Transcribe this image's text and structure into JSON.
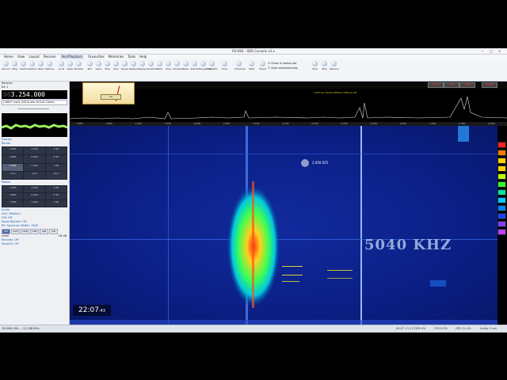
{
  "window": {
    "title": "RX-666 - SDR Console v3.x",
    "controls": [
      "—",
      "□",
      "✕"
    ]
  },
  "menu": [
    "Home",
    "View",
    "Layout",
    "Receive",
    "Rec/Playback",
    "Favourites",
    "Memories",
    "Tools",
    "Help"
  ],
  "menu_active_index": 4,
  "ribbon": {
    "buttons": [
      "Record",
      "Stop",
      "Cache",
      "Rewind",
      "Next",
      "Options",
      "Local",
      "Open",
      "Browse",
      "Run",
      "Open",
      "Stop",
      "Play",
      "Pause",
      "Rewind",
      "Replay",
      "Schedule",
      "Start",
      "Save",
      "Schedule",
      "Save",
      "Startle",
      "Navigation",
      "Satellite",
      "Tune",
      "Schedule",
      "Start",
      "Share",
      "Stop",
      "Stop",
      "Options"
    ],
    "checkbox_1": "Show in status bar",
    "checkbox_2": "Start automatically",
    "groups": [
      "Audio",
      "Data - Record",
      "Data - Playback",
      "Data - Schedule",
      "Video"
    ]
  },
  "leftpanel": {
    "receive_label": "Receive",
    "rx_label": "RX 1",
    "frequency_dim": "00",
    "frequency_main": "3.254.000",
    "source": "CABLE Input (VB-Audio Virtual Cable)",
    "display_label": "Display",
    "memory_label": "Bands",
    "memory_items": [
      "1.800",
      "3.500",
      "3.5R",
      "3.800",
      "5.000",
      "5.5R",
      "7.000",
      "7.200",
      "7.5R",
      "10.1",
      "14.0",
      "14.2"
    ],
    "modes_label": "Modes",
    "modes": [
      "AM",
      "SAM",
      "DSB",
      "USB",
      "LSB",
      "CW"
    ],
    "modes_selected_index": 0,
    "filter_label": "Audio",
    "filter_lines": [
      "AGC: Medium",
      "CW: Off",
      "Noise Blanker: Off",
      "RF: Spectrum Width: 192K"
    ],
    "level_label": "Level",
    "level_value": "18 dB",
    "bottom_lines": [
      "Records: Off",
      "Squelch: Off"
    ]
  },
  "main": {
    "smeter_value": "S9",
    "buttons": [
      "Scale",
      "Low",
      "High",
      "Zoom"
    ],
    "spectrum_annotation": "4.815 Kz, Radio Diffusion Bolivia AM",
    "cursor_freq": "2.050.925",
    "clock_hm": "22:07",
    "clock_s": ":43",
    "overlay_tag": "5040 KHZ",
    "axis_ticks": [
      "1.800",
      "1.850",
      "1.900",
      "1.950",
      "2.000",
      "2.050",
      "2.100",
      "2.150",
      "2.200",
      "2.250",
      "2.300",
      "2.350",
      "2.400",
      "2.450",
      "2.500"
    ]
  },
  "palette": [
    "#ff2020",
    "#ff7a00",
    "#ffd000",
    "#ffd000",
    "#c0ff00",
    "#30ff30",
    "#00e0a0",
    "#00c8ff",
    "#0080ff",
    "#2040ff",
    "#8040ff",
    "#c040ff"
  ],
  "status": {
    "left": "RX-666 49k — 12,288 MHz",
    "right_1": "00:07 +2,12 FIFB 0%",
    "right_2": "CPU 8.9%",
    "right_3": "GPU 21.0%",
    "right_4": "Audio: 9 ms"
  }
}
